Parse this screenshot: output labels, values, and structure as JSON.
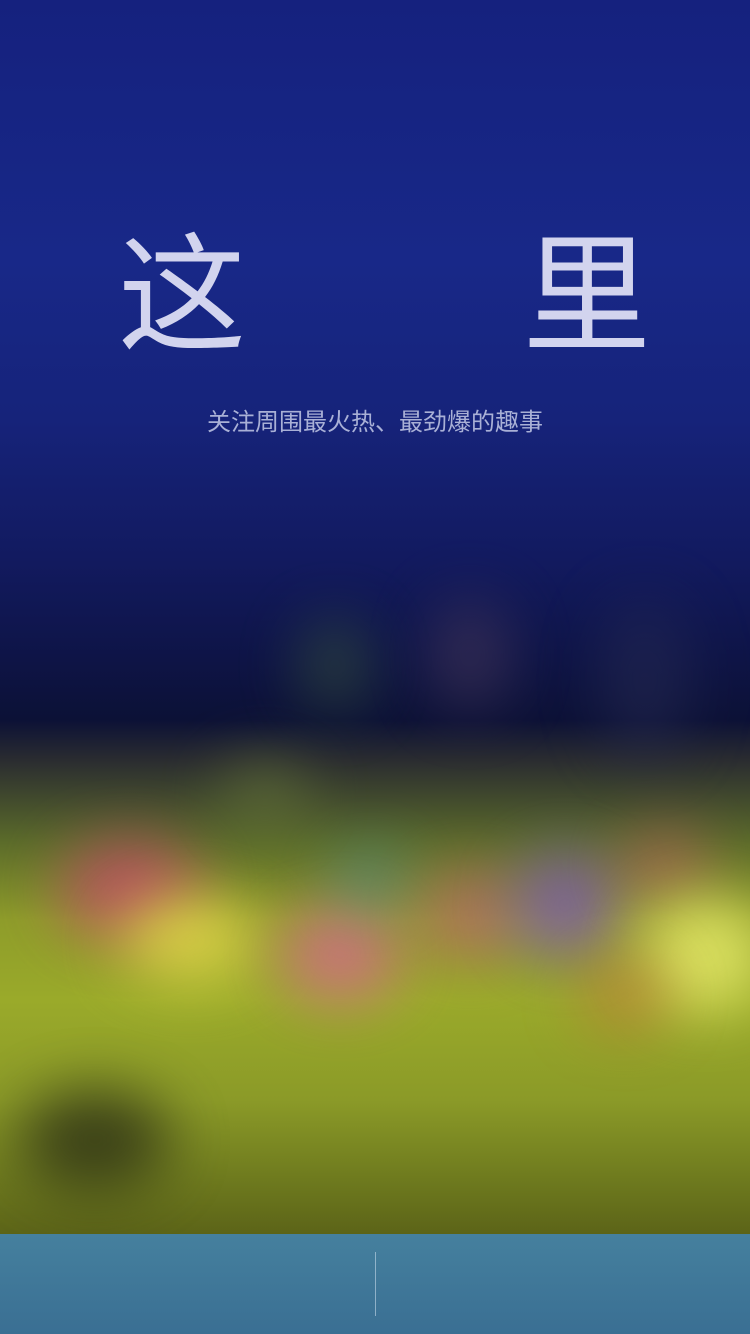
{
  "splash": {
    "title": "这 里",
    "subtitle": "关注周围最火热、最劲爆的趣事"
  },
  "colors": {
    "sky_top": "#15217e",
    "title_text": "#d2d4ee",
    "subtitle_text": "#a9b0d6",
    "bottom_bar": "#45809e"
  },
  "bottom_bar": {
    "left_button_label": "",
    "right_button_label": ""
  }
}
